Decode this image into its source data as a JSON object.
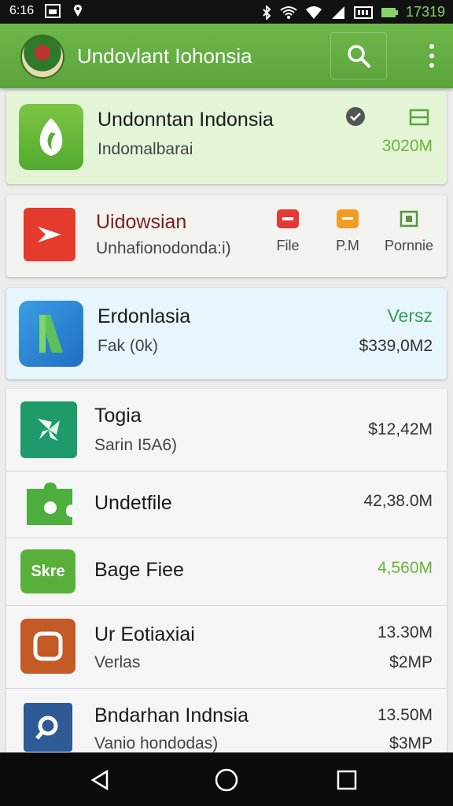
{
  "status": {
    "time": "6:16",
    "battery": "17319"
  },
  "appbar": {
    "title": "Undovlant Iohonsia"
  },
  "featured": {
    "title": "Undonntan Indonsia",
    "subtitle": "Indomalbarai",
    "size": "3020M"
  },
  "action_card": {
    "title": "Uidowsian",
    "subtitle": "Unhafionodonda:i)",
    "actions": [
      {
        "label": "File",
        "color": "#e53935"
      },
      {
        "label": "P.M",
        "color": "#f39c23"
      },
      {
        "label": "Pornnie",
        "color": "#4f9a3a"
      }
    ]
  },
  "selected_card": {
    "title": "Erdonlasia",
    "subtitle": "Fak (0k)",
    "top_right": "Versz",
    "size": "$339,0M2"
  },
  "list": [
    {
      "title": "Togia",
      "subtitle": "Sarin I5A6)",
      "size": "$12,42M",
      "icon": "pinwheel-icon",
      "icon_color": "#1f9a6b"
    },
    {
      "title": "Undetfile",
      "subtitle": "",
      "size": "42,38.0M",
      "icon": "puzzle-icon",
      "icon_color": "#4cae3c"
    },
    {
      "title": "Bage Fiee",
      "subtitle": "",
      "size": "4,560M",
      "icon": "badge-icon",
      "icon_color": "#58b03a",
      "badge_text": "Skre"
    },
    {
      "title": "Ur Eotiaxiai",
      "subtitle": "Verlas",
      "size": "13.30M",
      "size2": "$2MP",
      "icon": "frame-icon",
      "icon_color": "#c45a26"
    },
    {
      "title": "Bndarhan Indnsia",
      "subtitle": "Vanio hondodas)",
      "size": "13.50M",
      "size2": "$3MP",
      "icon": "search-lens-icon",
      "icon_color": "#2e5a95"
    }
  ]
}
